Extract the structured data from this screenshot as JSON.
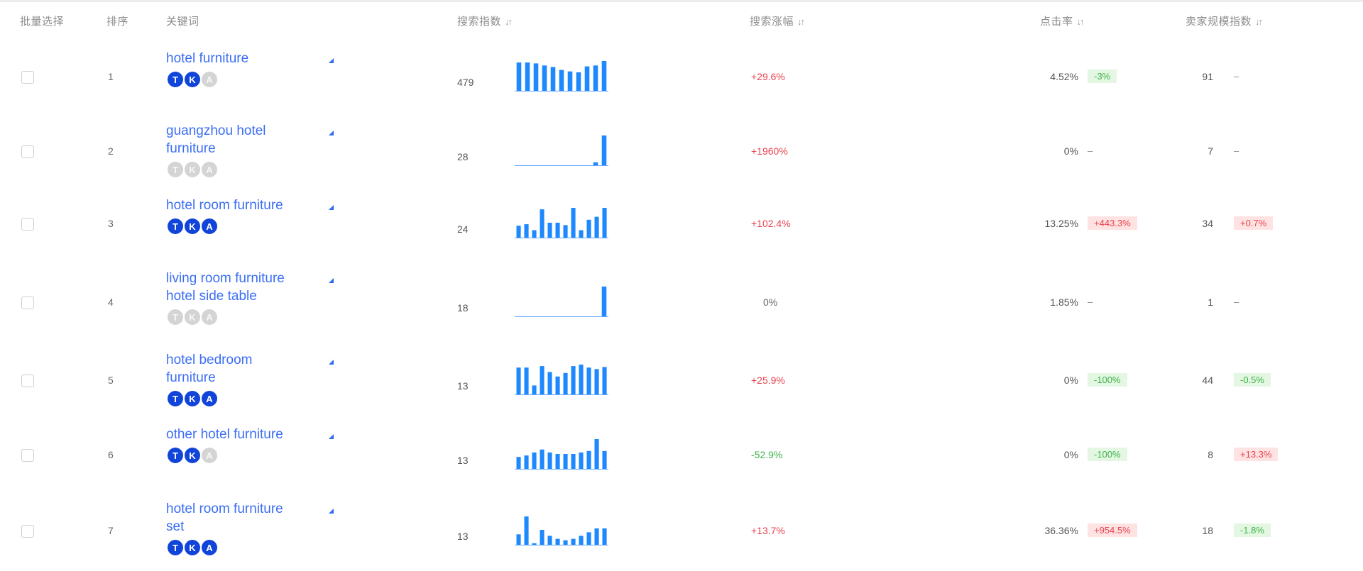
{
  "header": {
    "batch_select": "批量选择",
    "rank": "排序",
    "keyword": "关键词",
    "search_index": "搜索指数",
    "search_growth": "搜索涨幅",
    "ctr": "点击率",
    "seller_competition": "卖家规模指数"
  },
  "badge_letters": {
    "t": "T",
    "k": "K",
    "a": "A"
  },
  "colors": {
    "link": "#3b6ef5",
    "bar": "#1e88ff",
    "badge_on": "#1144d8",
    "badge_off": "#d4d4d4",
    "positive": "#e8434f",
    "negative": "#3eb249"
  },
  "rows": [
    {
      "rank": "1",
      "keyword_lines": [
        "hotel furniture"
      ],
      "badges": [
        true,
        true,
        false
      ],
      "search_index": "479",
      "spark": [
        0.95,
        0.95,
        0.92,
        0.85,
        0.8,
        0.7,
        0.65,
        0.62,
        0.82,
        0.85,
        1.0
      ],
      "growth": "+29.6%",
      "growth_dir": "pos",
      "ctr": "4.52%",
      "ctr_change": "-3%",
      "ctr_dir": "neg",
      "sellers": "91",
      "sellers_change": "–",
      "sellers_dir": "none"
    },
    {
      "rank": "2",
      "keyword_lines": [
        "guangzhou hotel",
        "furniture"
      ],
      "badges": [
        false,
        false,
        false
      ],
      "search_index": "28",
      "spark": [
        0,
        0,
        0,
        0,
        0,
        0,
        0,
        0,
        0,
        0.1,
        1.0
      ],
      "growth": "+1960%",
      "growth_dir": "pos",
      "ctr": "0%",
      "ctr_change": "–",
      "ctr_dir": "none",
      "sellers": "7",
      "sellers_change": "–",
      "sellers_dir": "none"
    },
    {
      "rank": "3",
      "keyword_lines": [
        "hotel room furniture"
      ],
      "badges": [
        true,
        true,
        true
      ],
      "search_index": "24",
      "spark": [
        0.4,
        0.45,
        0.25,
        0.95,
        0.5,
        0.5,
        0.42,
        1.0,
        0.25,
        0.6,
        0.7,
        1.0
      ],
      "growth": "+102.4%",
      "growth_dir": "pos",
      "ctr": "13.25%",
      "ctr_change": "+443.3%",
      "ctr_dir": "pos",
      "sellers": "34",
      "sellers_change": "+0.7%",
      "sellers_dir": "pos"
    },
    {
      "rank": "4",
      "keyword_lines": [
        "living room furniture",
        "hotel side table"
      ],
      "badges": [
        false,
        false,
        false
      ],
      "search_index": "18",
      "spark": [
        0,
        0,
        0,
        0,
        0,
        0,
        0,
        0,
        0,
        0,
        1.0
      ],
      "growth": "0%",
      "growth_dir": "zero",
      "ctr": "1.85%",
      "ctr_change": "–",
      "ctr_dir": "none",
      "sellers": "1",
      "sellers_change": "–",
      "sellers_dir": "none"
    },
    {
      "rank": "5",
      "keyword_lines": [
        "hotel bedroom",
        "furniture"
      ],
      "badges": [
        true,
        true,
        true
      ],
      "search_index": "13",
      "spark": [
        0.9,
        0.9,
        0.3,
        0.95,
        0.75,
        0.6,
        0.72,
        0.95,
        1.0,
        0.9,
        0.85,
        0.92
      ],
      "growth": "+25.9%",
      "growth_dir": "pos",
      "ctr": "0%",
      "ctr_change": "-100%",
      "ctr_dir": "neg",
      "sellers": "44",
      "sellers_change": "-0.5%",
      "sellers_dir": "neg"
    },
    {
      "rank": "6",
      "keyword_lines": [
        "other hotel furniture"
      ],
      "badges": [
        true,
        true,
        false
      ],
      "search_index": "13",
      "spark": [
        0.4,
        0.45,
        0.55,
        0.65,
        0.55,
        0.5,
        0.5,
        0.5,
        0.55,
        0.6,
        1.0,
        0.6
      ],
      "growth": "-52.9%",
      "growth_dir": "neg",
      "ctr": "0%",
      "ctr_change": "-100%",
      "ctr_dir": "neg",
      "sellers": "8",
      "sellers_change": "+13.3%",
      "sellers_dir": "pos"
    },
    {
      "rank": "7",
      "keyword_lines": [
        "hotel room furniture",
        "set"
      ],
      "badges": [
        true,
        true,
        true
      ],
      "search_index": "13",
      "spark": [
        0.35,
        0.95,
        0.05,
        0.5,
        0.3,
        0.2,
        0.15,
        0.2,
        0.3,
        0.42,
        0.55,
        0.55
      ],
      "growth": "+13.7%",
      "growth_dir": "pos",
      "ctr": "36.36%",
      "ctr_change": "+954.5%",
      "ctr_dir": "pos",
      "sellers": "18",
      "sellers_change": "-1.8%",
      "sellers_dir": "neg"
    }
  ]
}
